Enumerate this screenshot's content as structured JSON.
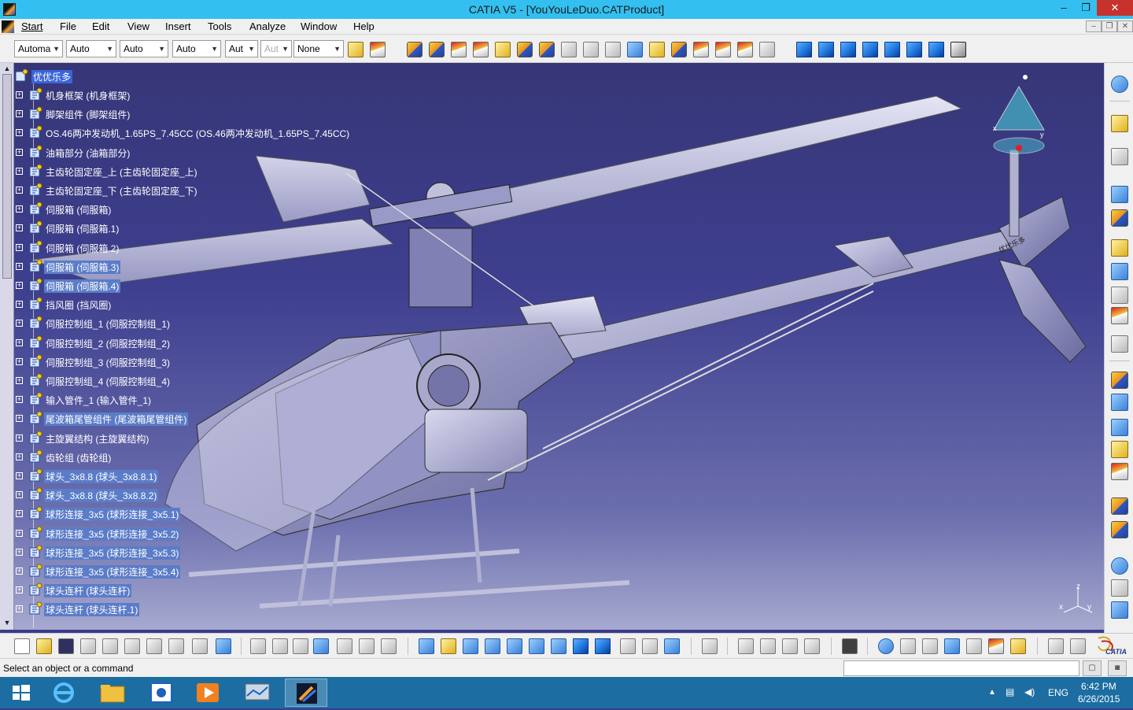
{
  "window": {
    "title": "CATIA V5 - [YouYouLeDuo.CATProduct]",
    "minimize": "–",
    "restore": "❐",
    "close": "✕"
  },
  "menu": {
    "items": [
      "Start",
      "File",
      "Edit",
      "View",
      "Insert",
      "Tools",
      "Analyze",
      "Window",
      "Help"
    ],
    "doc_minimize": "–",
    "doc_restore": "❐",
    "doc_close": "✕"
  },
  "graphic_properties": {
    "color": "Automa",
    "transparency": "Auto",
    "linetype": "Auto",
    "thickness": "Auto",
    "point": "Aut",
    "layer_point": "Aut",
    "layer": "None"
  },
  "tree": {
    "root": "优优乐多",
    "nodes": [
      "机身框架 (机身框架)",
      "脚架组件 (脚架组件)",
      "OS.46两冲发动机_1.65PS_7.45CC (OS.46两冲发动机_1.65PS_7.45CC)",
      "油箱部分 (油箱部分)",
      "主齿轮固定座_上 (主齿轮固定座_上)",
      "主齿轮固定座_下 (主齿轮固定座_下)",
      "伺服箱 (伺服箱)",
      "伺服箱 (伺服箱.1)",
      "伺服箱 (伺服箱.2)",
      "伺服箱 (伺服箱.3)",
      "伺服箱 (伺服箱.4)",
      "挡风圈 (挡风圈)",
      "伺服控制组_1 (伺服控制组_1)",
      "伺服控制组_2 (伺服控制组_2)",
      "伺服控制组_3 (伺服控制组_3)",
      "伺服控制组_4 (伺服控制组_4)",
      "输入管件_1 (输入管件_1)",
      "尾波箱尾管组件 (尾波箱尾管组件)",
      "主旋翼结构 (主旋翼结构)",
      "齿轮组 (齿轮组)",
      "球头_3x8.8 (球头_3x8.8.1)",
      "球头_3x8.8 (球头_3x8.8.2)",
      "球形连接_3x5 (球形连接_3x5.1)",
      "球形连接_3x5 (球形连接_3x5.2)",
      "球形连接_3x5 (球形连接_3x5.3)",
      "球形连接_3x5 (球形连接_3x5.4)",
      "球头连杆 (球头连杆)",
      "球头连杆 (球头连杆.1)"
    ],
    "highlighted": [
      9,
      10,
      17,
      20,
      21,
      22,
      23,
      24,
      25,
      26,
      27
    ]
  },
  "tail_label": "优优乐多",
  "status": {
    "prompt": "Select an object or a command",
    "command_value": ""
  },
  "taskbar": {
    "lang": "ENG",
    "time": "6:42 PM",
    "date": "6/26/2015"
  },
  "compass": {
    "x": "x",
    "y": "y",
    "z": "z"
  },
  "logo": "CATIA"
}
